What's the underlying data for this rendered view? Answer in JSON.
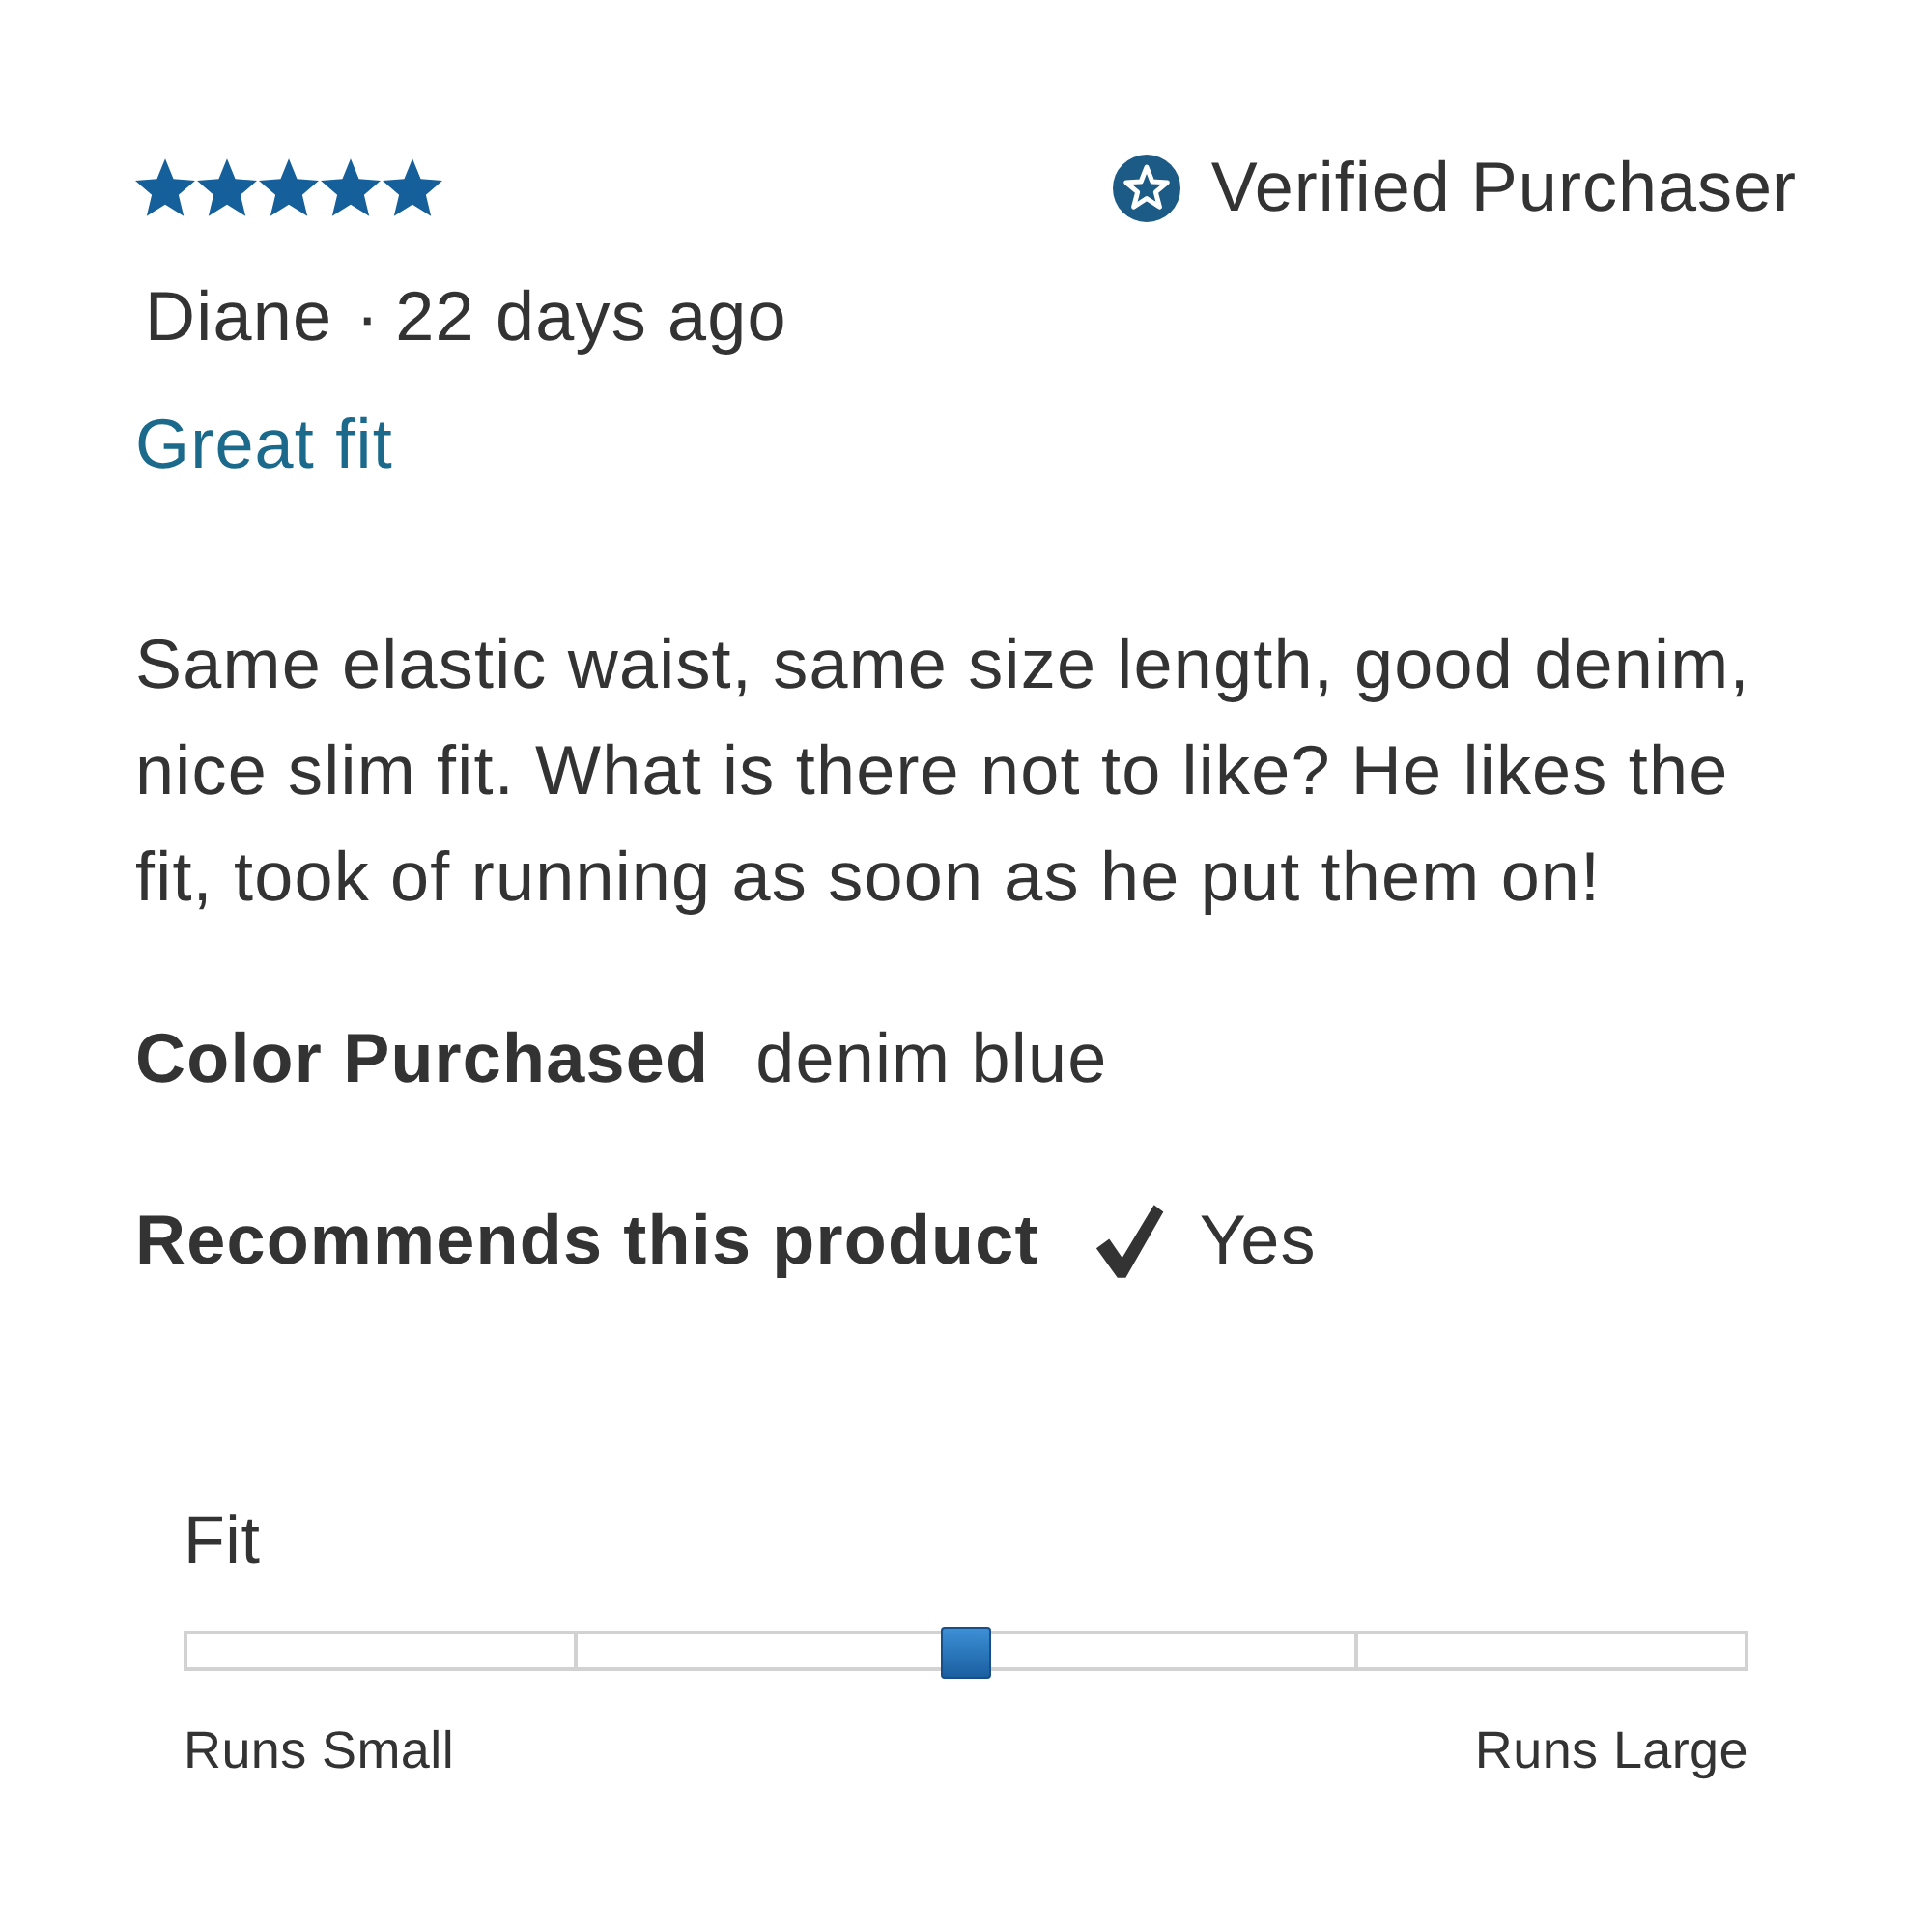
{
  "review": {
    "stars": 5,
    "verified_badge": "Verified Purchaser",
    "author": "Diane",
    "separator": "·",
    "date": "22 days ago",
    "title": "Great fit",
    "body": "Same elastic waist, same size length, good denim, nice slim fit. What is there not to like? He likes the fit, took of running as soon as he put them on!",
    "attributes": [
      {
        "kind": "text",
        "label": "Color Purchased",
        "value": "denim blue"
      },
      {
        "kind": "check",
        "label": "Recommends this product",
        "checked": true,
        "value": "Yes"
      }
    ]
  },
  "fit": {
    "label": "Fit",
    "level": 0.5,
    "min_label": "Runs Small",
    "max_label": "Runs Large"
  }
}
